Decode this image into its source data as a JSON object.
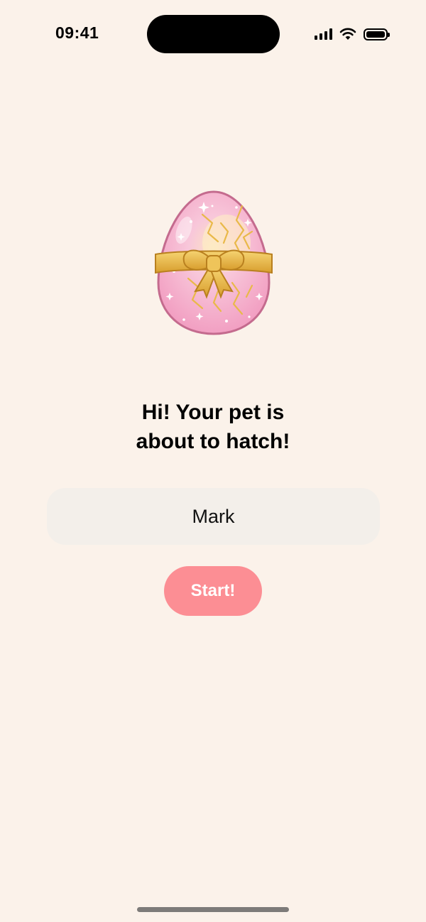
{
  "status_bar": {
    "time": "09:41",
    "icons": [
      "cellular-signal-icon",
      "wifi-icon",
      "battery-icon"
    ]
  },
  "hero": {
    "image": "pink-egg-with-gold-bow-icon",
    "title_line1": "Hi! Your pet is",
    "title_line2": "about to hatch!"
  },
  "name_input": {
    "value": "Mark"
  },
  "start_button": {
    "label": "Start!"
  },
  "colors": {
    "background": "#FBF2EA",
    "input_background": "#F3EFEA",
    "button": "#FC8E94",
    "egg_pink": "#F5A9C9",
    "bow_gold": "#E9B949"
  }
}
